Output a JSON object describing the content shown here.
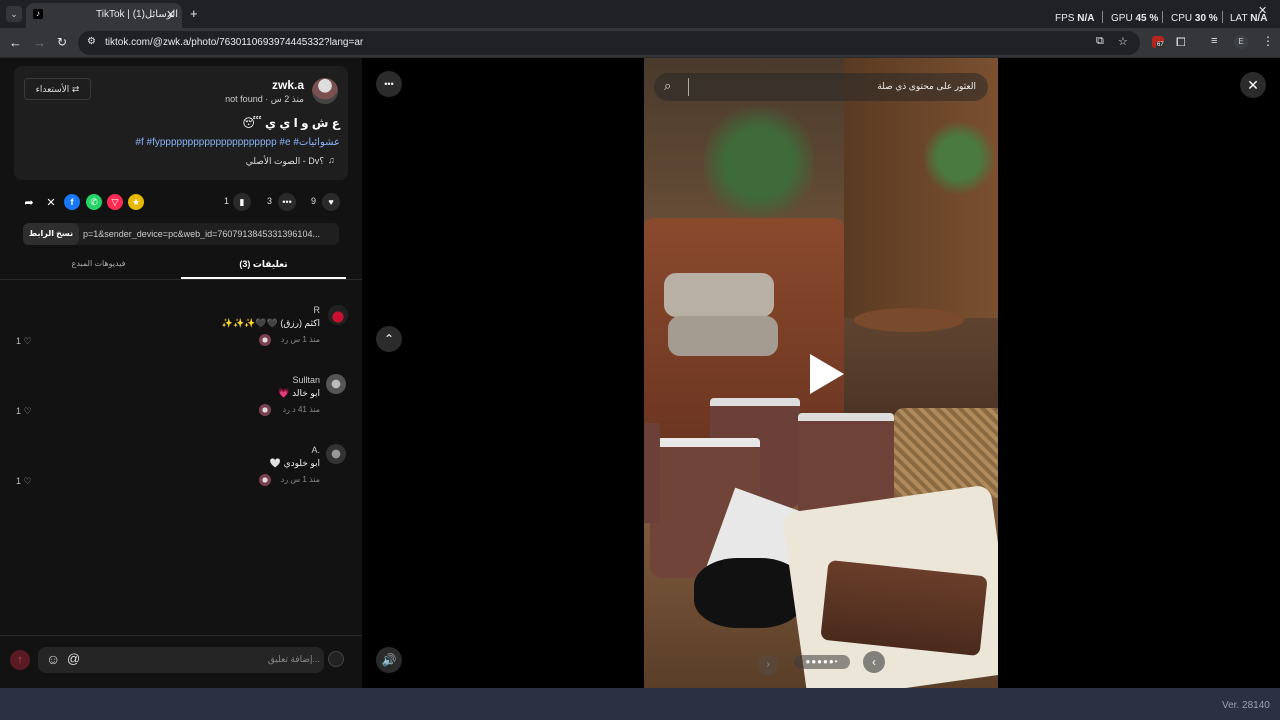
{
  "browser": {
    "tab_title": "TikTok | الرسائل(1)",
    "new_tab": "+",
    "url": "tiktok.com/@zwk.a/photo/7630110693974445332?lang=ar",
    "perf": {
      "fps_label": "FPS",
      "fps_value": "N/A",
      "gpu_label": "GPU",
      "gpu_value": "45 %",
      "cpu_label": "CPU",
      "cpu_value": "30 %",
      "lat_label": "LAT",
      "lat_value": "N/A"
    },
    "extension_badge": "67",
    "profile_initial": "E"
  },
  "post": {
    "username": "zwk.a",
    "subtitle": "not found · منذ 2 س",
    "repost_button": "الأستعداء",
    "caption": "ع ش و ا ي ي 😴",
    "hashtags": "#f #fyppppppppppppppppppppp #e #عشوائيات",
    "sound": "الصوت الأصلي - Dv؟",
    "likes": "9",
    "comments_count": "3",
    "saves": "1",
    "link_text": "p=1&sender_device=pc&web_id=7607913845331396104...",
    "copy_link": "نسخ الرابط"
  },
  "tabs": {
    "comments": "تعليقات (3)",
    "creator_videos": "فيديوهات المبدع"
  },
  "comments": [
    {
      "name": "R",
      "text": "اكثم (رزق) 🖤🖤✨✨✨",
      "meta": "منذ 1 س   رد",
      "likes": "1 ♡"
    },
    {
      "name": "Sulltan",
      "text": "ابو خالد 💗",
      "meta": "منذ 41 د   رد",
      "likes": "1 ♡"
    },
    {
      "name": "A.",
      "text": "ابو خلودي 🤍",
      "meta": "منذ 1 س   رد",
      "likes": "1 ♡"
    }
  ],
  "comment_input": {
    "placeholder": "إضافة تعليق...",
    "at": "@"
  },
  "viewer": {
    "search_placeholder": "العثور على محتوى ذي صلة",
    "more": "•••",
    "close": "✕"
  },
  "footer": {
    "version": "Ver. 28140"
  },
  "colors": {
    "accent": "#fe2c55",
    "link": "#8ab4f8",
    "panel": "#121212"
  }
}
